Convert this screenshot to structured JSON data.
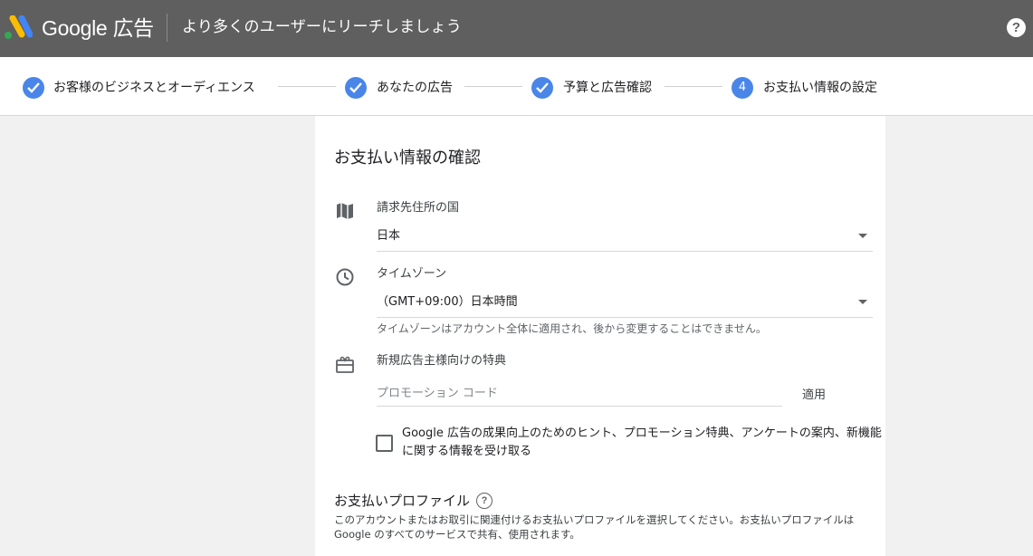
{
  "header": {
    "brand": "Google 広告",
    "tagline": "より多くのユーザーにリーチしましょう",
    "help_icon": "help-icon",
    "help_symbol": "?"
  },
  "stepper": {
    "steps": [
      {
        "label": "お客様のビジネスとオーディエンス",
        "state": "done"
      },
      {
        "label": "あなたの広告",
        "state": "done"
      },
      {
        "label": "予算と広告確認",
        "state": "done"
      },
      {
        "label": "お支払い情報の設定",
        "state": "current",
        "number": "4"
      }
    ],
    "accent": "#4a86e8"
  },
  "main": {
    "title": "お支払い情報の確認",
    "country": {
      "icon": "map-icon",
      "label": "請求先住所の国",
      "value": "日本"
    },
    "timezone": {
      "icon": "clock-icon",
      "label": "タイムゾーン",
      "value": "（GMT+09:00）日本時間",
      "hint": "タイムゾーンはアカウント全体に適用され、後から変更することはできません。"
    },
    "promo": {
      "icon": "gift-icon",
      "label": "新規広告主様向けの特典",
      "placeholder": "プロモーション コード",
      "apply_label": "適用"
    },
    "opt_in": {
      "checked": false,
      "label": "Google 広告の成果向上のためのヒント、プロモーション特典、アンケートの案内、新機能に関する情報を受け取る"
    },
    "payment_profile": {
      "title": "お支払いプロファイル",
      "help_symbol": "?",
      "description": "このアカウントまたはお取引に関連付けるお支払いプロファイルを選択してください。お支払いプロファイルは Google のすべてのサービスで共有、使用されます。"
    }
  }
}
